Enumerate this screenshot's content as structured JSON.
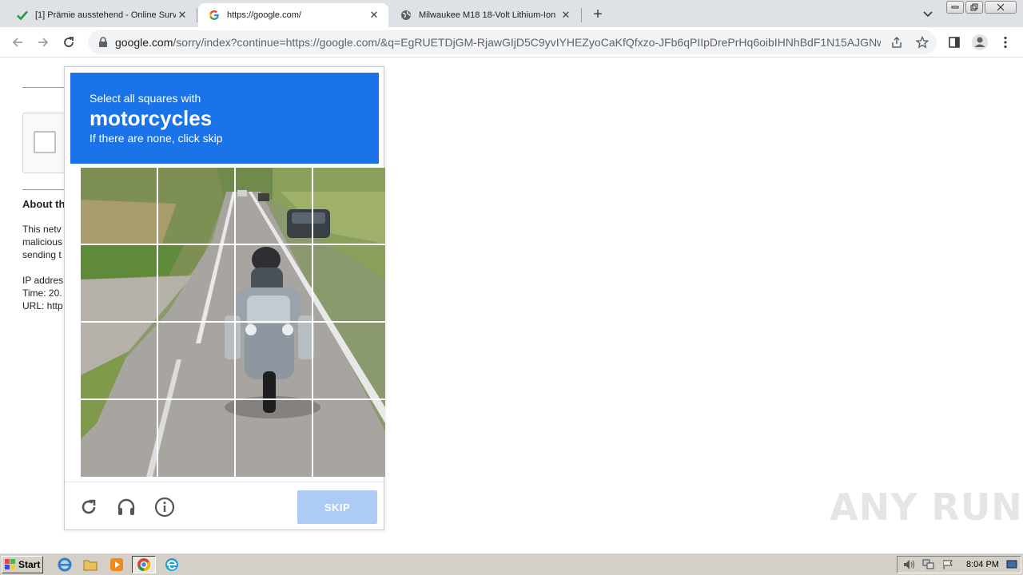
{
  "browser": {
    "tabs": [
      {
        "title": "[1] Prämie ausstehend - Online Surv",
        "favicon": "green-check-icon",
        "active": false
      },
      {
        "title": "https://google.com/",
        "favicon": "google-g-icon",
        "active": true
      },
      {
        "title": "Milwaukee M18 18-Volt Lithium-Ion",
        "favicon": "globe-icon",
        "active": false
      }
    ],
    "address_host": "google.com",
    "address_path": "/sorry/index?continue=https://google.com/&q=EgRUETDjGM-RjawGIjD5C9yvIYHEZyoCaKfQfxzo-JFb6qPIIpDrePrHq6oibIHNhBdF1N15AJGNw..."
  },
  "page": {
    "about_heading": "About th",
    "about_lines": [
      "This netv",
      "malicious",
      "sending t"
    ],
    "info_lines": [
      "IP addres",
      "Time: 20.",
      "URL: http"
    ]
  },
  "captcha": {
    "instruction": "Select all squares with",
    "keyword": "motorcycles",
    "hint": "If there are none, click skip",
    "skip_label": "SKIP",
    "header_color": "#1a73e8"
  },
  "watermark": "ANY RUN",
  "taskbar": {
    "start_label": "Start",
    "clock": "8:04 PM"
  }
}
